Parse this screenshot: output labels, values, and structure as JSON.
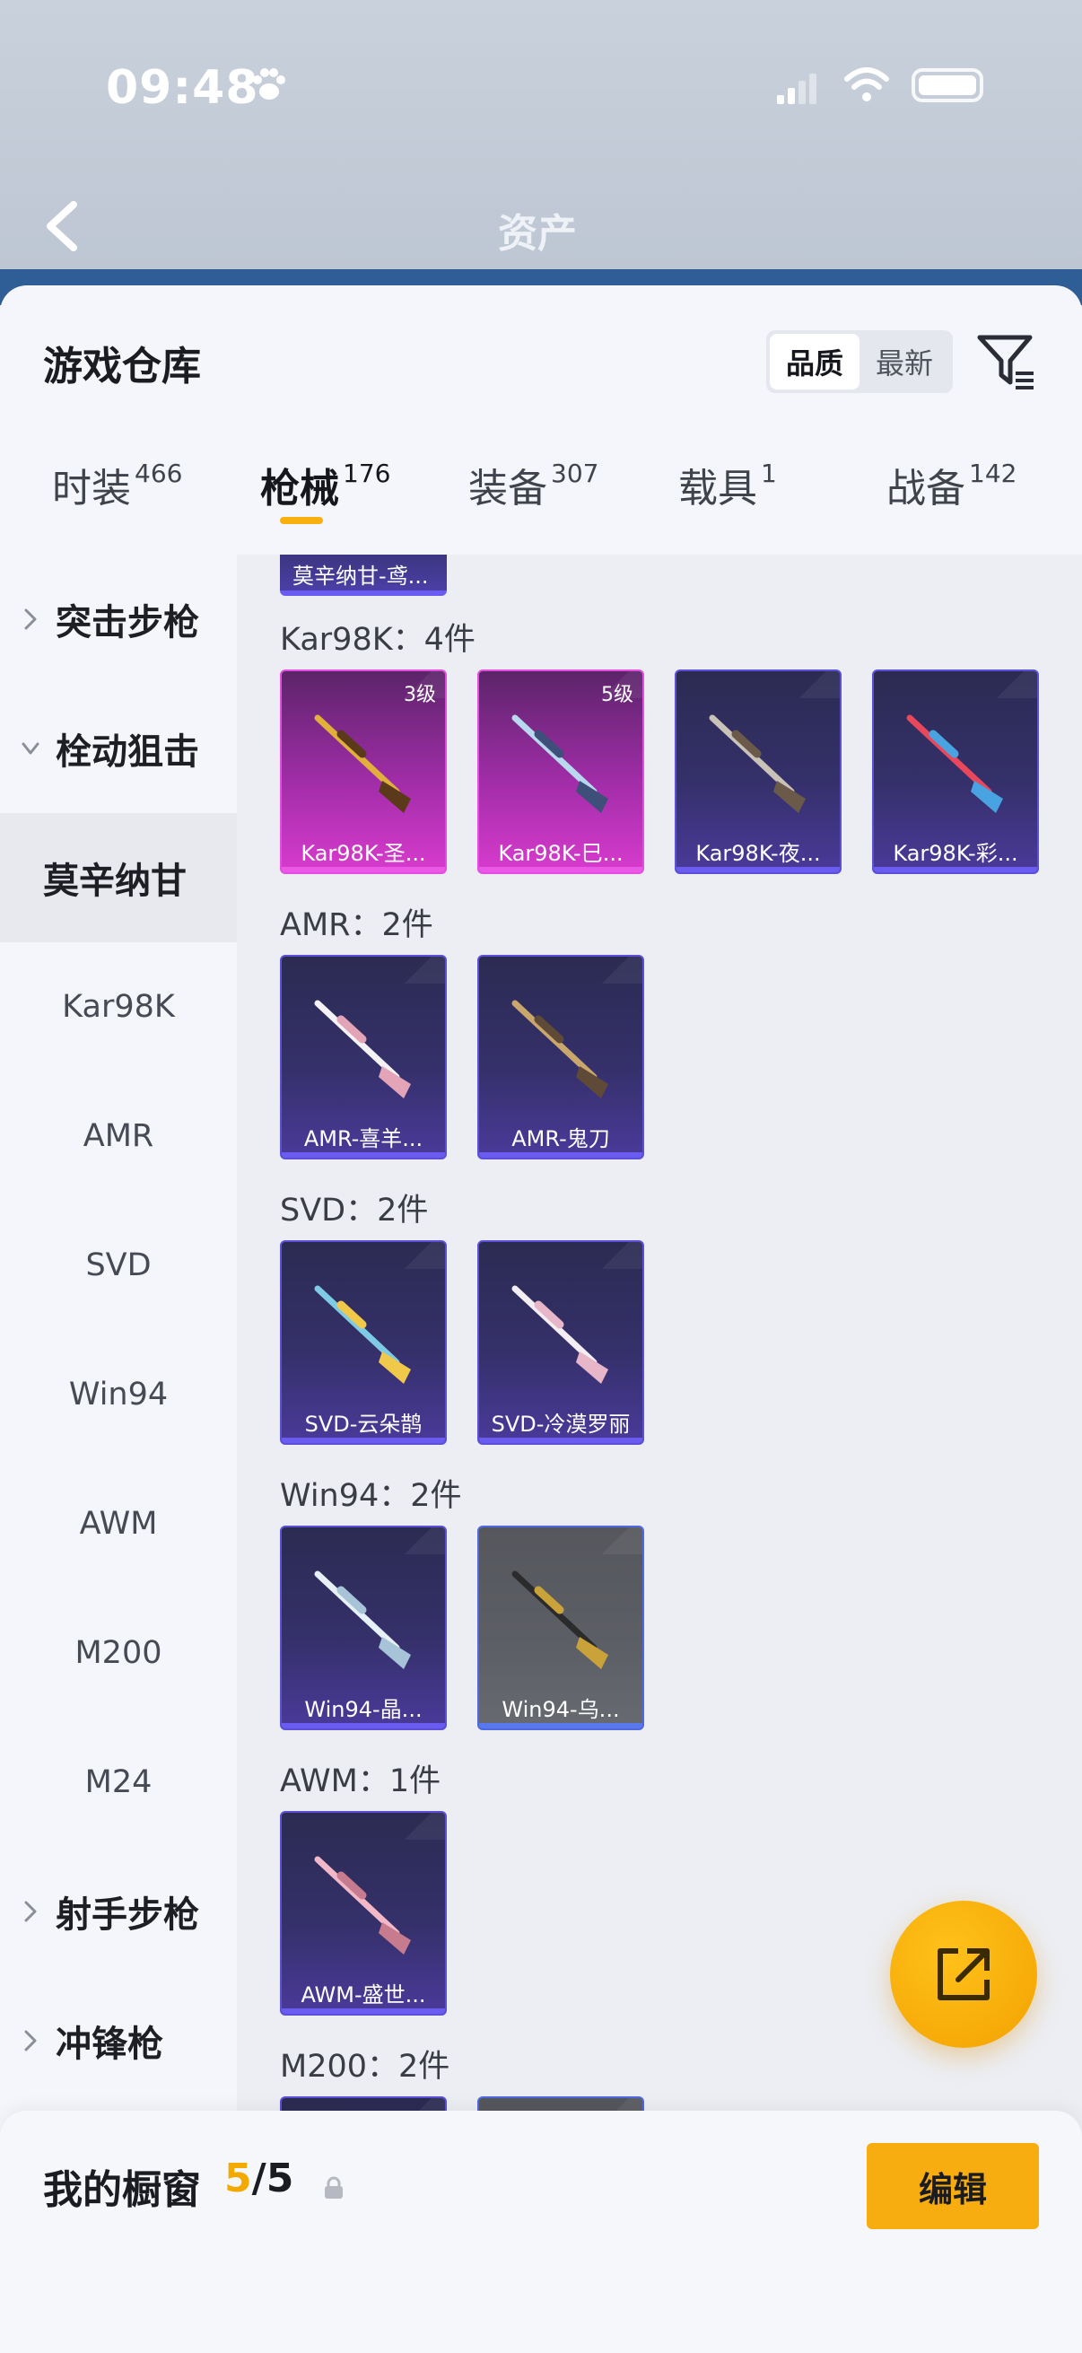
{
  "status": {
    "time": "09:48"
  },
  "header": {
    "back_title": "资产"
  },
  "sheet": {
    "title": "游戏仓库",
    "sort": {
      "options": [
        "品质",
        "最新"
      ],
      "selected": "品质"
    }
  },
  "tabs": [
    {
      "label": "时装",
      "count": "466",
      "active": false
    },
    {
      "label": "枪械",
      "count": "176",
      "active": true
    },
    {
      "label": "装备",
      "count": "307",
      "active": false
    },
    {
      "label": "载具",
      "count": "1",
      "active": false
    },
    {
      "label": "战备",
      "count": "142",
      "active": false
    }
  ],
  "nav": [
    {
      "label": "突击步枪",
      "kind": "group",
      "expanded": false
    },
    {
      "label": "栓动狙击",
      "kind": "group",
      "expanded": true
    },
    {
      "label": "莫辛纳甘",
      "kind": "selected"
    },
    {
      "label": "Kar98K",
      "kind": "sub"
    },
    {
      "label": "AMR",
      "kind": "sub"
    },
    {
      "label": "SVD",
      "kind": "sub"
    },
    {
      "label": "Win94",
      "kind": "sub"
    },
    {
      "label": "AWM",
      "kind": "sub"
    },
    {
      "label": "M200",
      "kind": "sub"
    },
    {
      "label": "M24",
      "kind": "sub"
    },
    {
      "label": "射手步枪",
      "kind": "group",
      "expanded": false
    },
    {
      "label": "冲锋枪",
      "kind": "group",
      "expanded": false
    }
  ],
  "content": {
    "partial_top_label": "莫辛纳甘-鸢...",
    "sections": [
      {
        "title": "Kar98K：4件",
        "items": [
          {
            "label": "Kar98K-圣...",
            "rarity": "pink",
            "level": "3级",
            "colors": [
              "#e0b03a",
              "#5a3a1a"
            ]
          },
          {
            "label": "Kar98K-巳...",
            "rarity": "pink",
            "level": "5级",
            "colors": [
              "#b8d8f0",
              "#3e4f7a"
            ]
          },
          {
            "label": "Kar98K-夜...",
            "rarity": "purple",
            "level": "",
            "colors": [
              "#c9c2b8",
              "#6b5a4a"
            ]
          },
          {
            "label": "Kar98K-彩...",
            "rarity": "purple",
            "level": "",
            "colors": [
              "#e8475c",
              "#49a3e0"
            ]
          }
        ]
      },
      {
        "title": "AMR：2件",
        "items": [
          {
            "label": "AMR-喜羊...",
            "rarity": "purple",
            "level": "",
            "colors": [
              "#f4f2f4",
              "#e3a4b8"
            ]
          },
          {
            "label": "AMR-鬼刀",
            "rarity": "purple",
            "level": "",
            "colors": [
              "#c9a66b",
              "#5e4a36"
            ]
          }
        ]
      },
      {
        "title": "SVD：2件",
        "items": [
          {
            "label": "SVD-云朵鹊",
            "rarity": "purple",
            "level": "",
            "colors": [
              "#7fcbe6",
              "#f0c84a"
            ]
          },
          {
            "label": "SVD-冷漠罗丽",
            "rarity": "purple",
            "level": "",
            "colors": [
              "#f3eef4",
              "#e7b6c9"
            ]
          }
        ]
      },
      {
        "title": "Win94：2件",
        "items": [
          {
            "label": "Win94-晶...",
            "rarity": "purple",
            "level": "",
            "colors": [
              "#e6f0f6",
              "#a7c3d8"
            ]
          },
          {
            "label": "Win94-乌...",
            "rarity": "grey",
            "level": "",
            "colors": [
              "#2b2b2b",
              "#c9a23a"
            ]
          }
        ]
      },
      {
        "title": "AWM：1件",
        "items": [
          {
            "label": "AWM-盛世...",
            "rarity": "purple",
            "level": "",
            "colors": [
              "#f2b8c8",
              "#c77b8e"
            ]
          }
        ]
      },
      {
        "title": "M200：2件",
        "items": [
          {
            "label": "",
            "rarity": "purple",
            "level": "",
            "colors": [
              "#444",
              "#444"
            ]
          },
          {
            "label": "",
            "rarity": "grey",
            "level": "",
            "colors": [
              "#444",
              "#444"
            ]
          }
        ]
      }
    ]
  },
  "bottom": {
    "title": "我的橱窗",
    "count_used": "5",
    "count_total": "/5",
    "edit_label": "编辑"
  },
  "colors": {
    "accent": "#f7ad0f",
    "tab_indicator": "#f7b010"
  }
}
